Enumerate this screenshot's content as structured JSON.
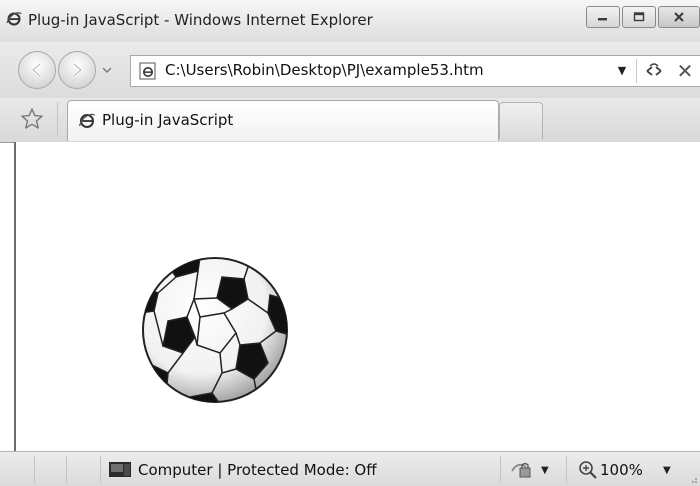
{
  "window": {
    "title": "Plug-in JavaScript - Windows Internet Explorer"
  },
  "address_bar": {
    "url": "C:\\Users\\Robin\\Desktop\\PJ\\example53.htm"
  },
  "tabs": [
    {
      "label": "Plug-in JavaScript"
    }
  ],
  "status_bar": {
    "zone": "Computer | Protected Mode: Off",
    "zoom": "100%"
  },
  "icons": {
    "browser": "internet-explorer-icon",
    "back": "back-arrow-icon",
    "forward": "forward-arrow-icon",
    "refresh": "refresh-icon",
    "stop": "stop-icon",
    "favorites": "star-icon",
    "zone": "computer-icon",
    "security": "security-lock-icon",
    "zoom": "zoom-magnifier-icon",
    "content_image": "soccer-ball-icon"
  },
  "colors": {
    "chrome_gray": "#e4e4e4",
    "content_bg": "#ffffff"
  }
}
